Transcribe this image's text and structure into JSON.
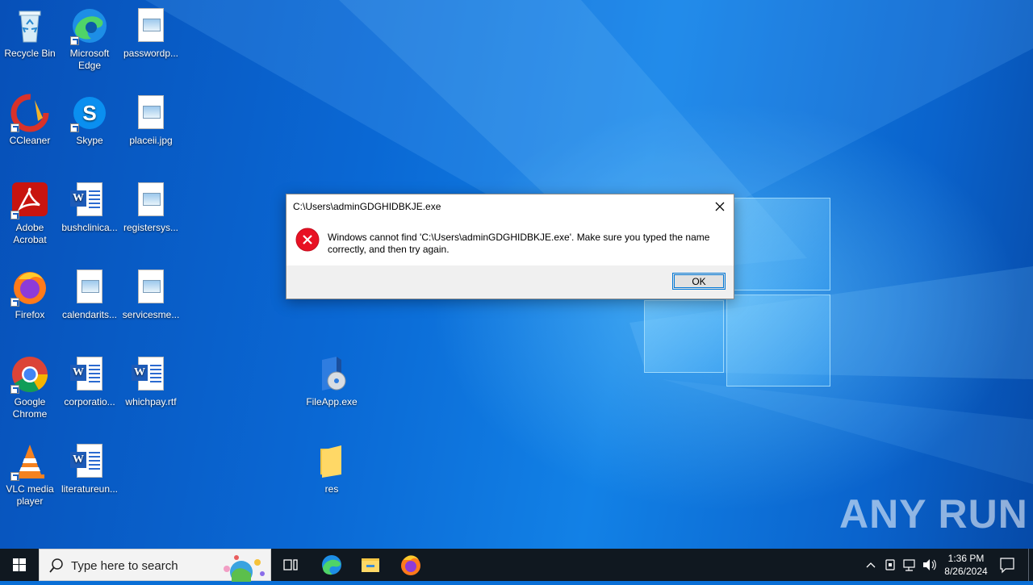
{
  "desktop": {
    "icons": [
      {
        "label": "Recycle Bin",
        "icon": "recycle-bin-icon"
      },
      {
        "label": "Microsoft Edge",
        "icon": "edge-icon"
      },
      {
        "label": "passwordp...",
        "icon": "image-file-icon"
      },
      {
        "label": "CCleaner",
        "icon": "ccleaner-icon"
      },
      {
        "label": "Skype",
        "icon": "skype-icon"
      },
      {
        "label": "placeii.jpg",
        "icon": "image-file-icon"
      },
      {
        "label": "Adobe Acrobat",
        "icon": "acrobat-icon"
      },
      {
        "label": "bushclinica...",
        "icon": "word-doc-icon"
      },
      {
        "label": "registersys...",
        "icon": "image-file-icon"
      },
      {
        "label": "Firefox",
        "icon": "firefox-icon"
      },
      {
        "label": "calendarits...",
        "icon": "image-file-icon"
      },
      {
        "label": "servicesme...",
        "icon": "image-file-icon"
      },
      {
        "label": "Google Chrome",
        "icon": "chrome-icon"
      },
      {
        "label": "corporatio...",
        "icon": "word-doc-icon"
      },
      {
        "label": "whichpay.rtf",
        "icon": "word-doc-icon"
      },
      {
        "label": "FileApp.exe",
        "icon": "installer-icon"
      },
      {
        "label": "VLC media player",
        "icon": "vlc-icon"
      },
      {
        "label": "literatureun...",
        "icon": "word-doc-icon"
      },
      {
        "label": "res",
        "icon": "folder-icon"
      }
    ]
  },
  "dialog": {
    "title": "C:\\Users\\adminGDGHIDBKJE.exe",
    "message": "Windows cannot find 'C:\\Users\\adminGDGHIDBKJE.exe'. Make sure you typed the name correctly, and then try again.",
    "ok_label": "OK"
  },
  "watermark": "ANY RUN",
  "taskbar": {
    "search_placeholder": "Type here to search",
    "time": "1:36 PM",
    "date": "8/26/2024"
  },
  "colors": {
    "desktop_blue": "#0a68d4",
    "taskbar": "#101820",
    "error_red": "#e81123",
    "focus_blue": "#0078d7"
  }
}
